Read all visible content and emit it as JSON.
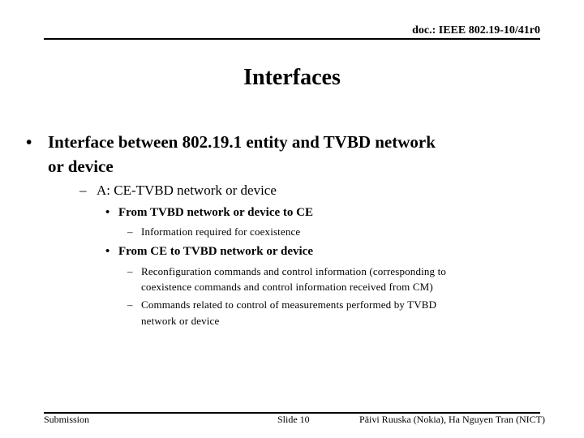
{
  "header": {
    "doc_id": "doc.: IEEE 802.19-10/41r0"
  },
  "slide": {
    "title": "Interfaces",
    "bullets": {
      "b1": {
        "marker": "•",
        "line1": "Interface between 802.19.1 entity and TVBD network",
        "line2": "or device"
      },
      "b1_1": {
        "marker": "–",
        "text": "A: CE-TVBD network or device"
      },
      "b1_1_1": {
        "marker": "•",
        "text": "From TVBD network or device to CE"
      },
      "b1_1_1_1": {
        "marker": "–",
        "text": "Information required for coexistence"
      },
      "b1_1_2": {
        "marker": "•",
        "text": "From CE to TVBD network or device"
      },
      "b1_1_2_1": {
        "marker": "–",
        "line1": "Reconfiguration commands and control information (corresponding to",
        "line2": "coexistence commands and control information received from CM)"
      },
      "b1_1_2_2": {
        "marker": "–",
        "line1": "Commands related to control of measurements performed by TVBD",
        "line2": "network or device"
      }
    }
  },
  "footer": {
    "left": "Submission",
    "center": "Slide 10",
    "right": "Päivi Ruuska (Nokia), Ha Nguyen Tran (NICT)"
  }
}
